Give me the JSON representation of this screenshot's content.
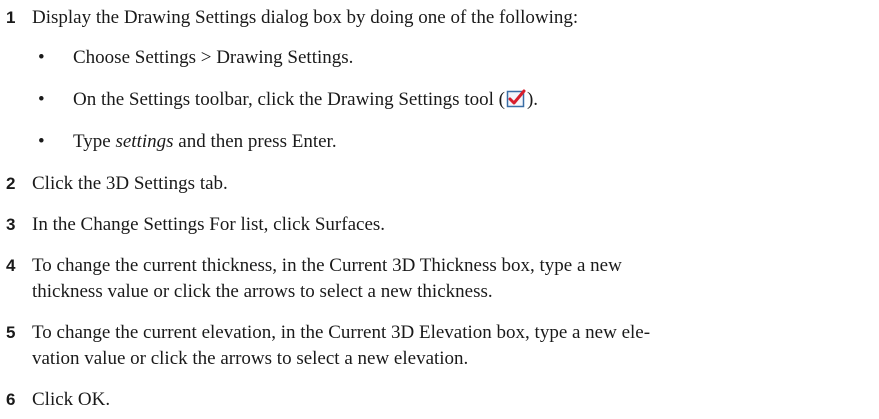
{
  "steps": [
    {
      "number": "1",
      "text": "Display the Drawing Settings dialog box by doing one of the following:",
      "bullets": [
        {
          "text": "Choose Settings > Drawing Settings."
        },
        {
          "before": "On the Settings toolbar, click the Drawing Settings tool (",
          "icon": "drawing-settings-checkmark-icon",
          "after": ")."
        },
        {
          "italic": "settings",
          "after": " and then press Enter.",
          "before": "Type "
        }
      ]
    },
    {
      "number": "2",
      "text": "Click the 3D Settings tab."
    },
    {
      "number": "3",
      "text": "In the Change Settings For list, click Surfaces."
    },
    {
      "number": "4",
      "lines": [
        "To change the current thickness, in the Current 3D Thickness box, type a new",
        "thickness value or click the arrows to select a new thickness."
      ]
    },
    {
      "number": "5",
      "lines": [
        "To change the current elevation, in the Current 3D Elevation box, type a new ele-",
        "vation value or click the arrows to select a new elevation."
      ]
    },
    {
      "number": "6",
      "text": "Click OK."
    }
  ],
  "bullet_glyph": "•",
  "colors": {
    "text": "#1a1a1a",
    "icon_check": "#d81e2c",
    "icon_box_border": "#3a6ea5"
  }
}
